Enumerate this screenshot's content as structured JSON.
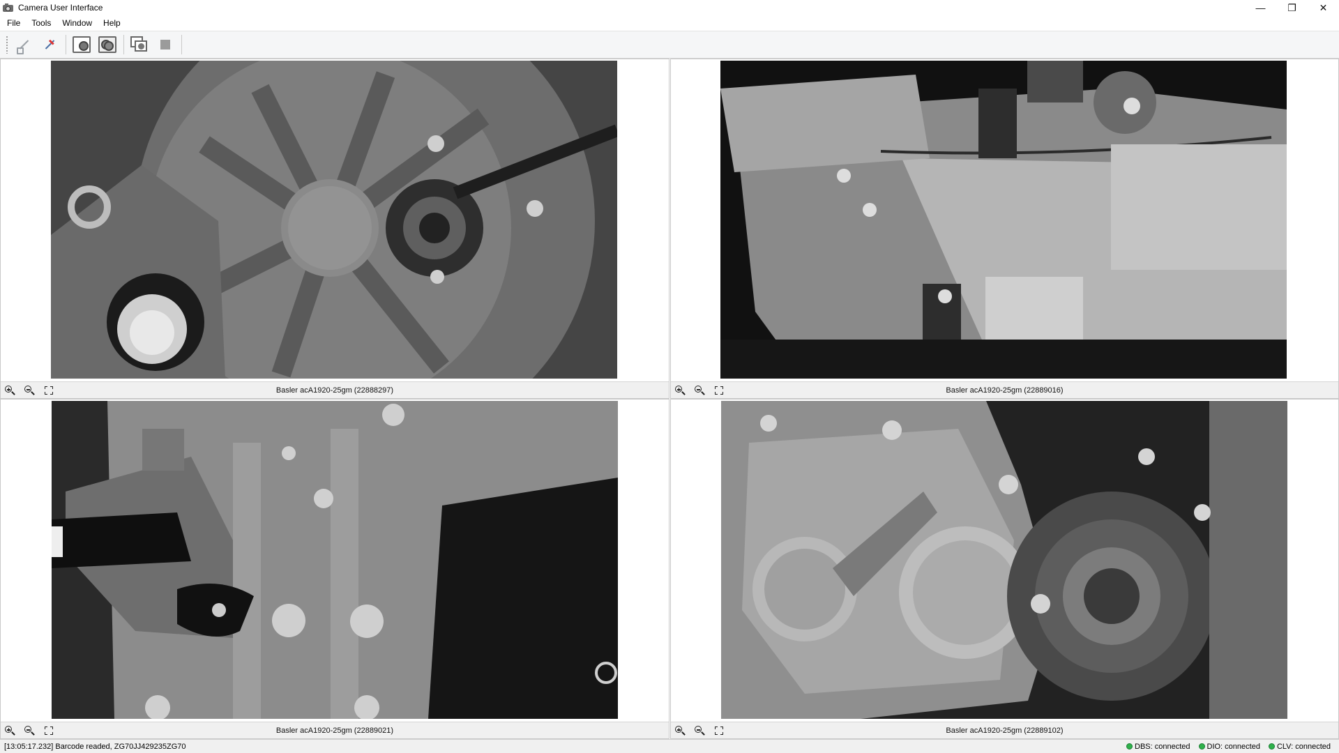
{
  "window": {
    "title": "Camera User Interface",
    "controls": {
      "minimize": "—",
      "restore": "❐",
      "close": "✕"
    }
  },
  "menu": [
    "File",
    "Tools",
    "Window",
    "Help"
  ],
  "toolbar": {
    "buttons": [
      "connect-icon",
      "disconnect-icon",
      "single-snapshot-icon",
      "multi-snapshot-icon",
      "live-view-icon",
      "stop-icon"
    ]
  },
  "cameras": [
    {
      "label": "Basler acA1920-25gm (22888297)"
    },
    {
      "label": "Basler acA1920-25gm (22889016)"
    },
    {
      "label": "Basler acA1920-25gm (22889021)"
    },
    {
      "label": "Basler acA1920-25gm (22889102)"
    }
  ],
  "status": {
    "message": "[13:05:17.232] Barcode readed, ZG70JJ429235ZG70",
    "indicators": [
      {
        "label": "DBS: connected",
        "color": "#2fb14b"
      },
      {
        "label": "DIO: connected",
        "color": "#2fb14b"
      },
      {
        "label": "CLV: connected",
        "color": "#2fb14b"
      }
    ]
  }
}
